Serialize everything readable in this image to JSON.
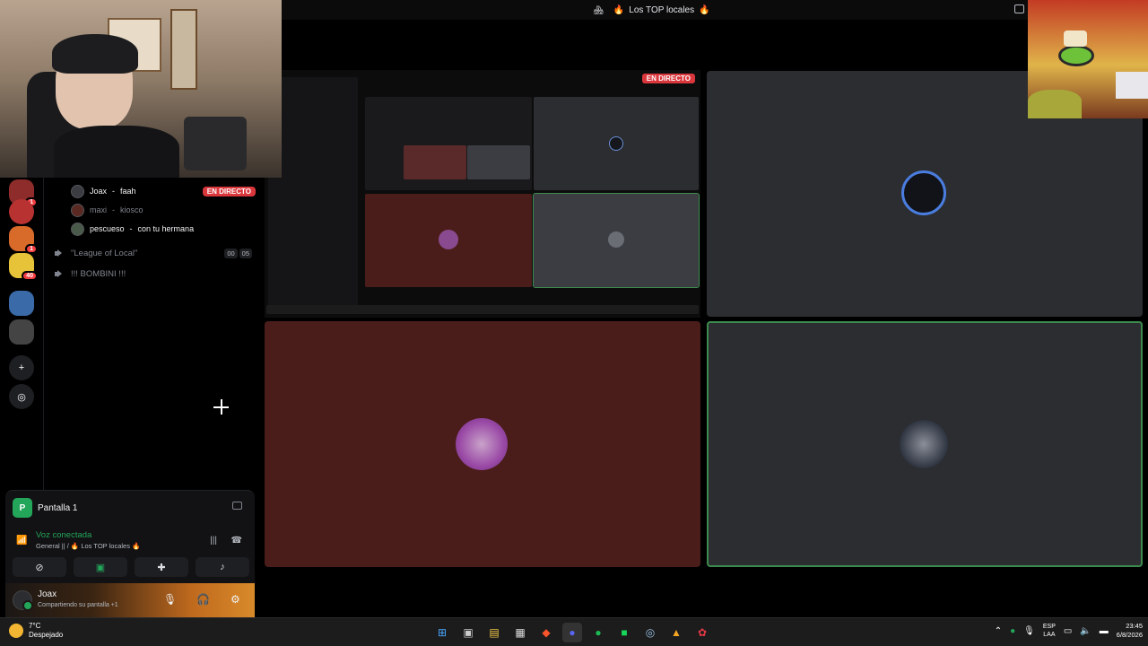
{
  "window": {
    "title": "Los TOP locales",
    "title_decor_left": "🏘",
    "title_flame_left": "🔥",
    "title_flame_right": "🔥"
  },
  "rail": {
    "servers": [
      {
        "name": "server-1",
        "badge": "1",
        "color": "#8e2b2b"
      },
      {
        "name": "server-2",
        "badge": "",
        "color": "#b83232"
      },
      {
        "name": "server-3",
        "badge": "1",
        "color": "#d86a2a"
      },
      {
        "name": "server-4",
        "badge": "40",
        "color": "#e7c33a"
      },
      {
        "name": "server-5",
        "badge": "",
        "color": "#3a6aa8"
      },
      {
        "name": "server-6",
        "badge": "",
        "color": "#444"
      }
    ],
    "add_label": "+",
    "discover_label": "◎"
  },
  "voice": {
    "users": [
      {
        "name": "Joax",
        "activity": "faah",
        "live": "EN DIRECTO",
        "state": "bright"
      },
      {
        "name": "maxi",
        "activity": "kiosco",
        "live": "",
        "state": "dim"
      },
      {
        "name": "pescueso",
        "activity": "con tu hermana",
        "live": "",
        "state": "bright"
      }
    ],
    "channels": [
      {
        "name": "\"League of Local\"",
        "count_a": "00",
        "count_b": "05"
      },
      {
        "name": "!!! BOMBINI !!!",
        "count_a": "",
        "count_b": ""
      }
    ]
  },
  "screen_panel": {
    "title": "Pantalla 1",
    "icon_letter": "P",
    "status": "Voz conectada",
    "location": "General || / 🔥 Los TOP locales 🔥"
  },
  "user_panel": {
    "name": "Joax",
    "status": "Compartiendo su pantalla +1"
  },
  "stage": {
    "live_label": "EN DIRECTO"
  },
  "taskbar": {
    "temp": "7°C",
    "weather": "Despejado",
    "lang_1": "ESP",
    "lang_2": "LAA",
    "time": "23:45",
    "date": "6/8/2026"
  },
  "colors": {
    "live_red": "#da373c",
    "connected_green": "#23a55a",
    "tile_red": "#4a1d1a",
    "tile_gray": "#2b2d31"
  }
}
